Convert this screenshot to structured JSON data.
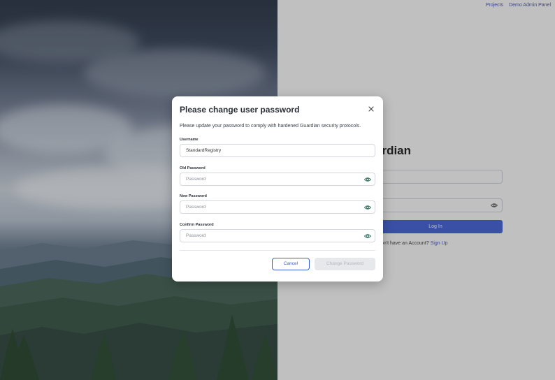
{
  "topnav": {
    "projects": "Projects",
    "admin_panel": "Demo Admin Panel"
  },
  "login": {
    "title": "ardian",
    "login_button": "Log In",
    "signup_prompt": "on't have an Account?",
    "signup_link": "Sign Up"
  },
  "modal": {
    "title": "Please change user password",
    "description": "Please update your password to comply with hardened Guardian security protocols.",
    "username": {
      "label": "Username",
      "value": "StandardRegistry"
    },
    "old_password": {
      "label": "Old Password",
      "placeholder": "Password"
    },
    "new_password": {
      "label": "New Password",
      "placeholder": "Password"
    },
    "confirm_password": {
      "label": "Confirm Password",
      "placeholder": "Password"
    },
    "cancel_label": "Cancel",
    "change_label": "Change Password"
  },
  "colors": {
    "accent": "#3a5bd9",
    "disabled_bg": "#e6e8ec"
  }
}
